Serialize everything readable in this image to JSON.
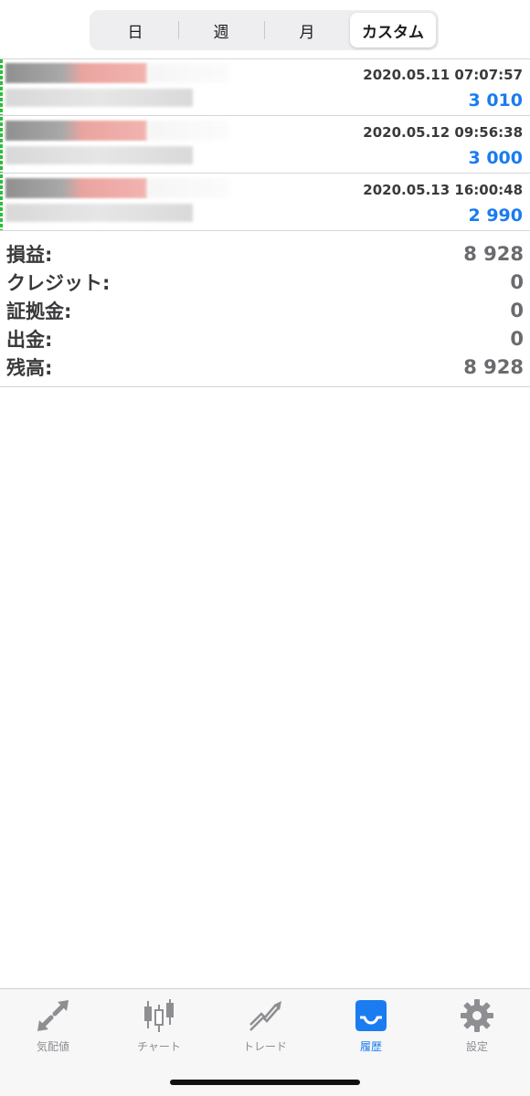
{
  "period_tabs": [
    "日",
    "週",
    "月",
    "カスタム"
  ],
  "active_period_tab": "カスタム",
  "deals": [
    {
      "time": "2020.05.11 07:07:57",
      "profit": "3 010"
    },
    {
      "time": "2020.05.12 09:56:38",
      "profit": "3 000"
    },
    {
      "time": "2020.05.13 16:00:48",
      "profit": "2 990"
    }
  ],
  "summary": [
    {
      "label": "損益:",
      "value": "8 928"
    },
    {
      "label": "クレジット:",
      "value": "0"
    },
    {
      "label": "証拠金:",
      "value": "0"
    },
    {
      "label": "出金:",
      "value": "0"
    },
    {
      "label": "残高:",
      "value": "8 928"
    }
  ],
  "tab_bar": [
    {
      "label": "気配値",
      "icon": "quotes-arrows-icon"
    },
    {
      "label": "チャート",
      "icon": "candlestick-chart-icon"
    },
    {
      "label": "トレード",
      "icon": "trade-trend-icon"
    },
    {
      "label": "履歴",
      "icon": "history-inbox-icon"
    },
    {
      "label": "設定",
      "icon": "settings-gear-icon"
    }
  ],
  "active_tab": "履歴",
  "colors": {
    "accent_blue": "#1a7cf0",
    "inactive_gray": "#8e8e93",
    "buy_marker_green": "#2bbf3a",
    "text_dark": "#3a3a3c"
  }
}
